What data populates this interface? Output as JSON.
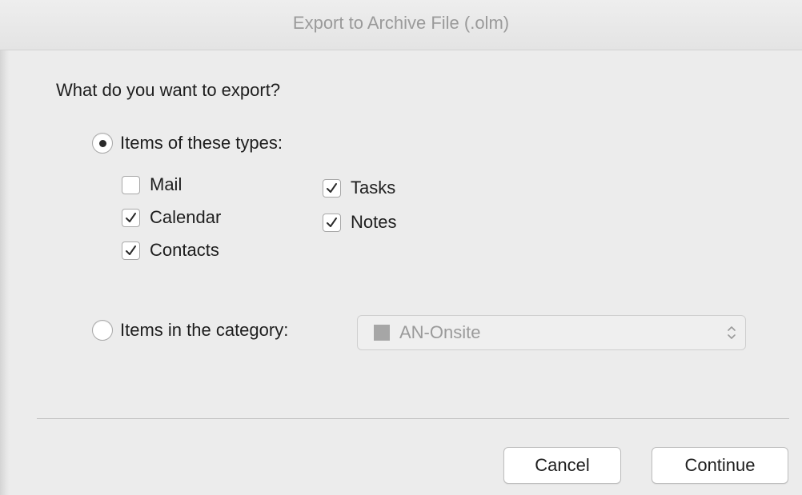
{
  "window": {
    "title": "Export to Archive File (.olm)"
  },
  "question": "What do you want to export?",
  "option_types": {
    "label": "Items of these types:",
    "selected": true,
    "items": [
      {
        "label": "Mail",
        "checked": false
      },
      {
        "label": "Calendar",
        "checked": true
      },
      {
        "label": "Contacts",
        "checked": true
      },
      {
        "label": "Tasks",
        "checked": true
      },
      {
        "label": "Notes",
        "checked": true
      }
    ]
  },
  "option_category": {
    "label": "Items in the category:",
    "selected": false,
    "select_value": "AN-Onsite",
    "swatch_color": "#a6a6a6"
  },
  "buttons": {
    "cancel": "Cancel",
    "continue": "Continue"
  }
}
